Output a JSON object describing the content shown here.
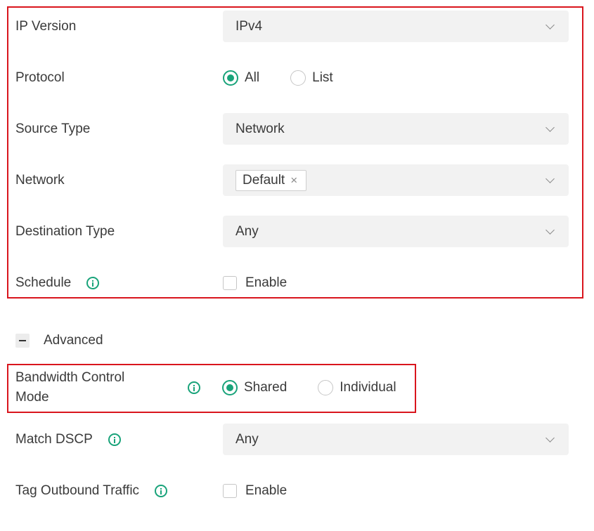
{
  "colors": {
    "accent": "#19a37a",
    "highlight_border": "#d9151d",
    "field_bg": "#f2f2f2"
  },
  "form": {
    "ip_version": {
      "label": "IP Version",
      "value": "IPv4"
    },
    "protocol": {
      "label": "Protocol",
      "options": [
        "All",
        "List"
      ],
      "selected": "All"
    },
    "source_type": {
      "label": "Source Type",
      "value": "Network"
    },
    "network": {
      "label": "Network",
      "tags": [
        "Default"
      ],
      "tag_close": "×"
    },
    "destination_type": {
      "label": "Destination Type",
      "value": "Any"
    },
    "schedule": {
      "label": "Schedule",
      "checkbox_label": "Enable",
      "checked": false,
      "icon": "info-icon"
    }
  },
  "advanced": {
    "label": "Advanced",
    "toggle_icon": "minus-icon",
    "bandwidth_control_mode": {
      "label_line1": "Bandwidth Control",
      "label_line2": "Mode",
      "options": [
        "Shared",
        "Individual"
      ],
      "selected": "Shared",
      "icon": "info-icon"
    },
    "match_dscp": {
      "label": "Match DSCP",
      "value": "Any",
      "icon": "info-icon"
    },
    "tag_outbound_traffic": {
      "label": "Tag Outbound Traffic",
      "checkbox_label": "Enable",
      "checked": false,
      "icon": "info-icon"
    }
  }
}
